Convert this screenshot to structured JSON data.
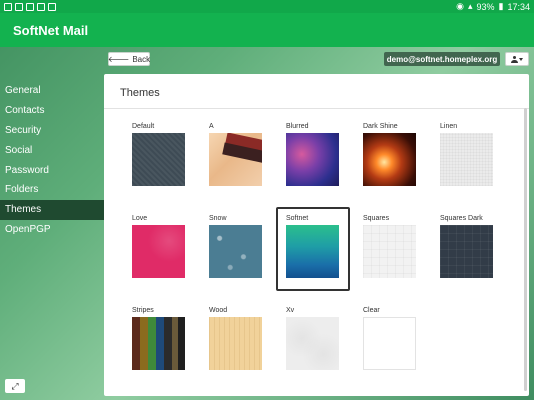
{
  "status_bar": {
    "battery": "93%",
    "time": "17:34"
  },
  "app": {
    "title": "SoftNet Mail"
  },
  "toolbar": {
    "back_label": "Back",
    "account_email": "demo@softnet.homeplex.org"
  },
  "sidebar": {
    "items": [
      {
        "label": "General"
      },
      {
        "label": "Contacts"
      },
      {
        "label": "Security"
      },
      {
        "label": "Social"
      },
      {
        "label": "Password"
      },
      {
        "label": "Folders"
      },
      {
        "label": "Themes",
        "active": true
      },
      {
        "label": "OpenPGP"
      }
    ]
  },
  "panel": {
    "title": "Themes",
    "selected_theme": "Softnet",
    "themes": [
      {
        "name": "Default"
      },
      {
        "name": "A"
      },
      {
        "name": "Blurred"
      },
      {
        "name": "Dark Shine"
      },
      {
        "name": "Linen"
      },
      {
        "name": "Love"
      },
      {
        "name": "Snow"
      },
      {
        "name": "Softnet"
      },
      {
        "name": "Squares"
      },
      {
        "name": "Squares Dark"
      },
      {
        "name": "Stripes"
      },
      {
        "name": "Wood"
      },
      {
        "name": "Xv"
      },
      {
        "name": "Clear"
      }
    ]
  },
  "colors": {
    "status_bar": "#11a84a",
    "app_bar": "#13b24f",
    "account_badge": "#41664f",
    "sidebar_active": "#1f4a30"
  }
}
